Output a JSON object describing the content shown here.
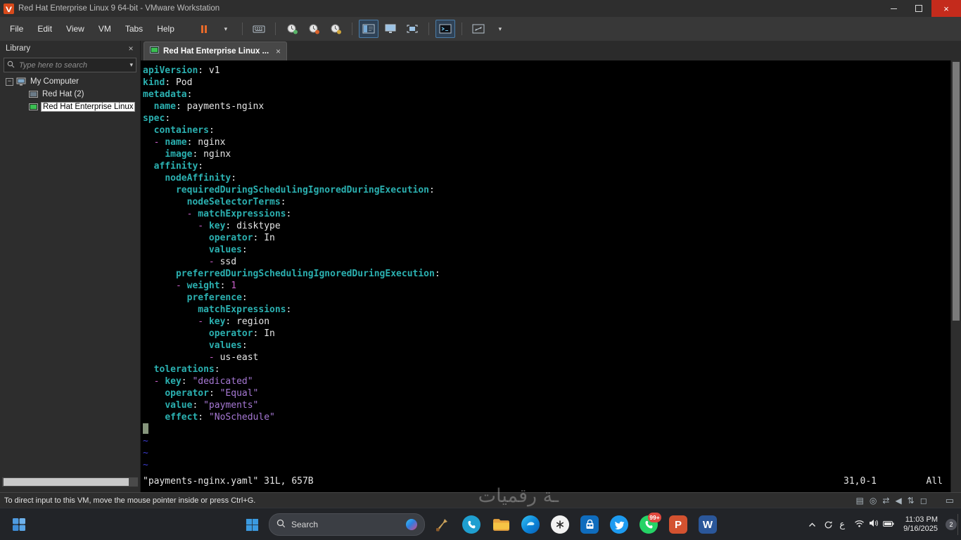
{
  "window": {
    "title": "Red Hat Enterprise Linux 9 64-bit - VMware Workstation"
  },
  "menubar": {
    "menus": [
      "File",
      "Edit",
      "View",
      "VM",
      "Tabs",
      "Help"
    ],
    "toolbar": [
      {
        "name": "power-pause-button",
        "kind": "pause"
      },
      {
        "name": "power-options-dropdown",
        "kind": "caret"
      },
      {
        "kind": "sep"
      },
      {
        "name": "send-ctrl-alt-del-button",
        "kind": "cad"
      },
      {
        "kind": "sep"
      },
      {
        "name": "take-snapshot-button",
        "kind": "snap",
        "accent": "#58b368"
      },
      {
        "name": "revert-snapshot-button",
        "kind": "snap",
        "accent": "#d9622b"
      },
      {
        "name": "manage-snapshots-button",
        "kind": "snap",
        "accent": "#d0a63a"
      },
      {
        "kind": "sep"
      },
      {
        "name": "show-library-button",
        "kind": "panel",
        "active": true
      },
      {
        "name": "thumbnail-bar-button",
        "kind": "console"
      },
      {
        "name": "console-view-button",
        "kind": "corners"
      },
      {
        "kind": "sep"
      },
      {
        "name": "launch-terminal-button",
        "kind": "term",
        "active": true
      },
      {
        "kind": "sep"
      },
      {
        "name": "fullscreen-button",
        "kind": "fit"
      },
      {
        "name": "fullscreen-dropdown",
        "kind": "caret"
      }
    ]
  },
  "sidebar": {
    "header": "Library",
    "search_placeholder": "Type here to search",
    "tree": [
      {
        "label": "My Computer",
        "level": 0,
        "icon": "computer",
        "expander": true
      },
      {
        "label": "Red Hat  (2)",
        "level": 1,
        "icon": "vm"
      },
      {
        "label": "Red Hat Enterprise Linux",
        "level": 1,
        "icon": "vm-running",
        "selected": true
      }
    ]
  },
  "tabs": [
    {
      "label": "Red Hat Enterprise Linux ..."
    }
  ],
  "vim": {
    "lines": [
      [
        [
          "k",
          "apiVersion"
        ],
        [
          "t",
          ": v1"
        ]
      ],
      [
        [
          "k",
          "kind"
        ],
        [
          "t",
          ": Pod"
        ]
      ],
      [
        [
          "k",
          "metadata"
        ],
        [
          "t",
          ":"
        ]
      ],
      [
        [
          "t",
          "  "
        ],
        [
          "k",
          "name"
        ],
        [
          "t",
          ": payments-nginx"
        ]
      ],
      [
        [
          "k",
          "spec"
        ],
        [
          "t",
          ":"
        ]
      ],
      [
        [
          "t",
          "  "
        ],
        [
          "k",
          "containers"
        ],
        [
          "t",
          ":"
        ]
      ],
      [
        [
          "t",
          "  "
        ],
        [
          "d",
          "- "
        ],
        [
          "k",
          "name"
        ],
        [
          "t",
          ": nginx"
        ]
      ],
      [
        [
          "t",
          "    "
        ],
        [
          "k",
          "image"
        ],
        [
          "t",
          ": nginx"
        ]
      ],
      [
        [
          "t",
          "  "
        ],
        [
          "k",
          "affinity"
        ],
        [
          "t",
          ":"
        ]
      ],
      [
        [
          "t",
          "    "
        ],
        [
          "k",
          "nodeAffinity"
        ],
        [
          "t",
          ":"
        ]
      ],
      [
        [
          "t",
          "      "
        ],
        [
          "k",
          "requiredDuringSchedulingIgnoredDuringExecution"
        ],
        [
          "t",
          ":"
        ]
      ],
      [
        [
          "t",
          "        "
        ],
        [
          "k",
          "nodeSelectorTerms"
        ],
        [
          "t",
          ":"
        ]
      ],
      [
        [
          "t",
          "        "
        ],
        [
          "d",
          "- "
        ],
        [
          "k",
          "matchExpressions"
        ],
        [
          "t",
          ":"
        ]
      ],
      [
        [
          "t",
          "          "
        ],
        [
          "d",
          "- "
        ],
        [
          "k",
          "key"
        ],
        [
          "t",
          ": disktype"
        ]
      ],
      [
        [
          "t",
          "            "
        ],
        [
          "k",
          "operator"
        ],
        [
          "t",
          ": In"
        ]
      ],
      [
        [
          "t",
          "            "
        ],
        [
          "k",
          "values"
        ],
        [
          "t",
          ":"
        ]
      ],
      [
        [
          "t",
          "            "
        ],
        [
          "d",
          "- "
        ],
        [
          "t",
          "ssd"
        ]
      ],
      [
        [
          "t",
          "      "
        ],
        [
          "k",
          "preferredDuringSchedulingIgnoredDuringExecution"
        ],
        [
          "t",
          ":"
        ]
      ],
      [
        [
          "t",
          "      "
        ],
        [
          "d",
          "- "
        ],
        [
          "k",
          "weight"
        ],
        [
          "t",
          ": "
        ],
        [
          "n",
          "1"
        ]
      ],
      [
        [
          "t",
          "        "
        ],
        [
          "k",
          "preference"
        ],
        [
          "t",
          ":"
        ]
      ],
      [
        [
          "t",
          "          "
        ],
        [
          "k",
          "matchExpressions"
        ],
        [
          "t",
          ":"
        ]
      ],
      [
        [
          "t",
          "          "
        ],
        [
          "d",
          "- "
        ],
        [
          "k",
          "key"
        ],
        [
          "t",
          ": region"
        ]
      ],
      [
        [
          "t",
          "            "
        ],
        [
          "k",
          "operator"
        ],
        [
          "t",
          ": In"
        ]
      ],
      [
        [
          "t",
          "            "
        ],
        [
          "k",
          "values"
        ],
        [
          "t",
          ":"
        ]
      ],
      [
        [
          "t",
          "            "
        ],
        [
          "d",
          "- "
        ],
        [
          "t",
          "us-east"
        ]
      ],
      [
        [
          "t",
          "  "
        ],
        [
          "k",
          "tolerations"
        ],
        [
          "t",
          ":"
        ]
      ],
      [
        [
          "t",
          "  "
        ],
        [
          "d",
          "- "
        ],
        [
          "k",
          "key"
        ],
        [
          "t",
          ": "
        ],
        [
          "s",
          "\"dedicated\""
        ]
      ],
      [
        [
          "t",
          "    "
        ],
        [
          "k",
          "operator"
        ],
        [
          "t",
          ": "
        ],
        [
          "s",
          "\"Equal\""
        ]
      ],
      [
        [
          "t",
          "    "
        ],
        [
          "k",
          "value"
        ],
        [
          "t",
          ": "
        ],
        [
          "s",
          "\"payments\""
        ]
      ],
      [
        [
          "t",
          "    "
        ],
        [
          "k",
          "effect"
        ],
        [
          "t",
          ": "
        ],
        [
          "s",
          "\"NoSchedule\""
        ]
      ]
    ],
    "tilde_count": 3,
    "status_left": "\"payments-nginx.yaml\" 31L, 657B",
    "ruler": "31,0-1",
    "scroll_pos": "All"
  },
  "statusbar": {
    "hint": "To direct input to this VM, move the mouse pointer inside or press Ctrl+G.",
    "devices": [
      {
        "name": "hard-disk-icon",
        "glyph": "▤"
      },
      {
        "name": "cd-dvd-icon",
        "glyph": "◎"
      },
      {
        "name": "network-adapter-icon",
        "glyph": "⇄"
      },
      {
        "name": "sound-icon",
        "glyph": "◀"
      },
      {
        "name": "usb-icon",
        "glyph": "⇅"
      },
      {
        "name": "display-icon",
        "glyph": "◻"
      }
    ],
    "log_glyph": "▭"
  },
  "taskbar": {
    "search_label": "Search",
    "apps": [
      {
        "name": "game-launcher-icon",
        "kind": "dagger"
      },
      {
        "name": "phone-link-icon",
        "kind": "phone"
      },
      {
        "name": "file-explorer-icon",
        "kind": "folder"
      },
      {
        "name": "edge-browser-icon",
        "kind": "edge"
      },
      {
        "name": "chatgpt-icon",
        "kind": "chatgpt"
      },
      {
        "name": "microsoft-store-icon",
        "kind": "store"
      },
      {
        "name": "twitter-icon",
        "kind": "twitter"
      },
      {
        "name": "whatsapp-icon",
        "kind": "whatsapp",
        "badge": "99+"
      },
      {
        "name": "powerpoint-icon",
        "kind": "ppt"
      },
      {
        "name": "word-icon",
        "kind": "word"
      }
    ],
    "tray": {
      "language": "ع",
      "time": "11:03 PM",
      "date": "9/16/2025",
      "notification_count": "2"
    }
  },
  "watermark": {
    "text": "ـة رقميات"
  }
}
